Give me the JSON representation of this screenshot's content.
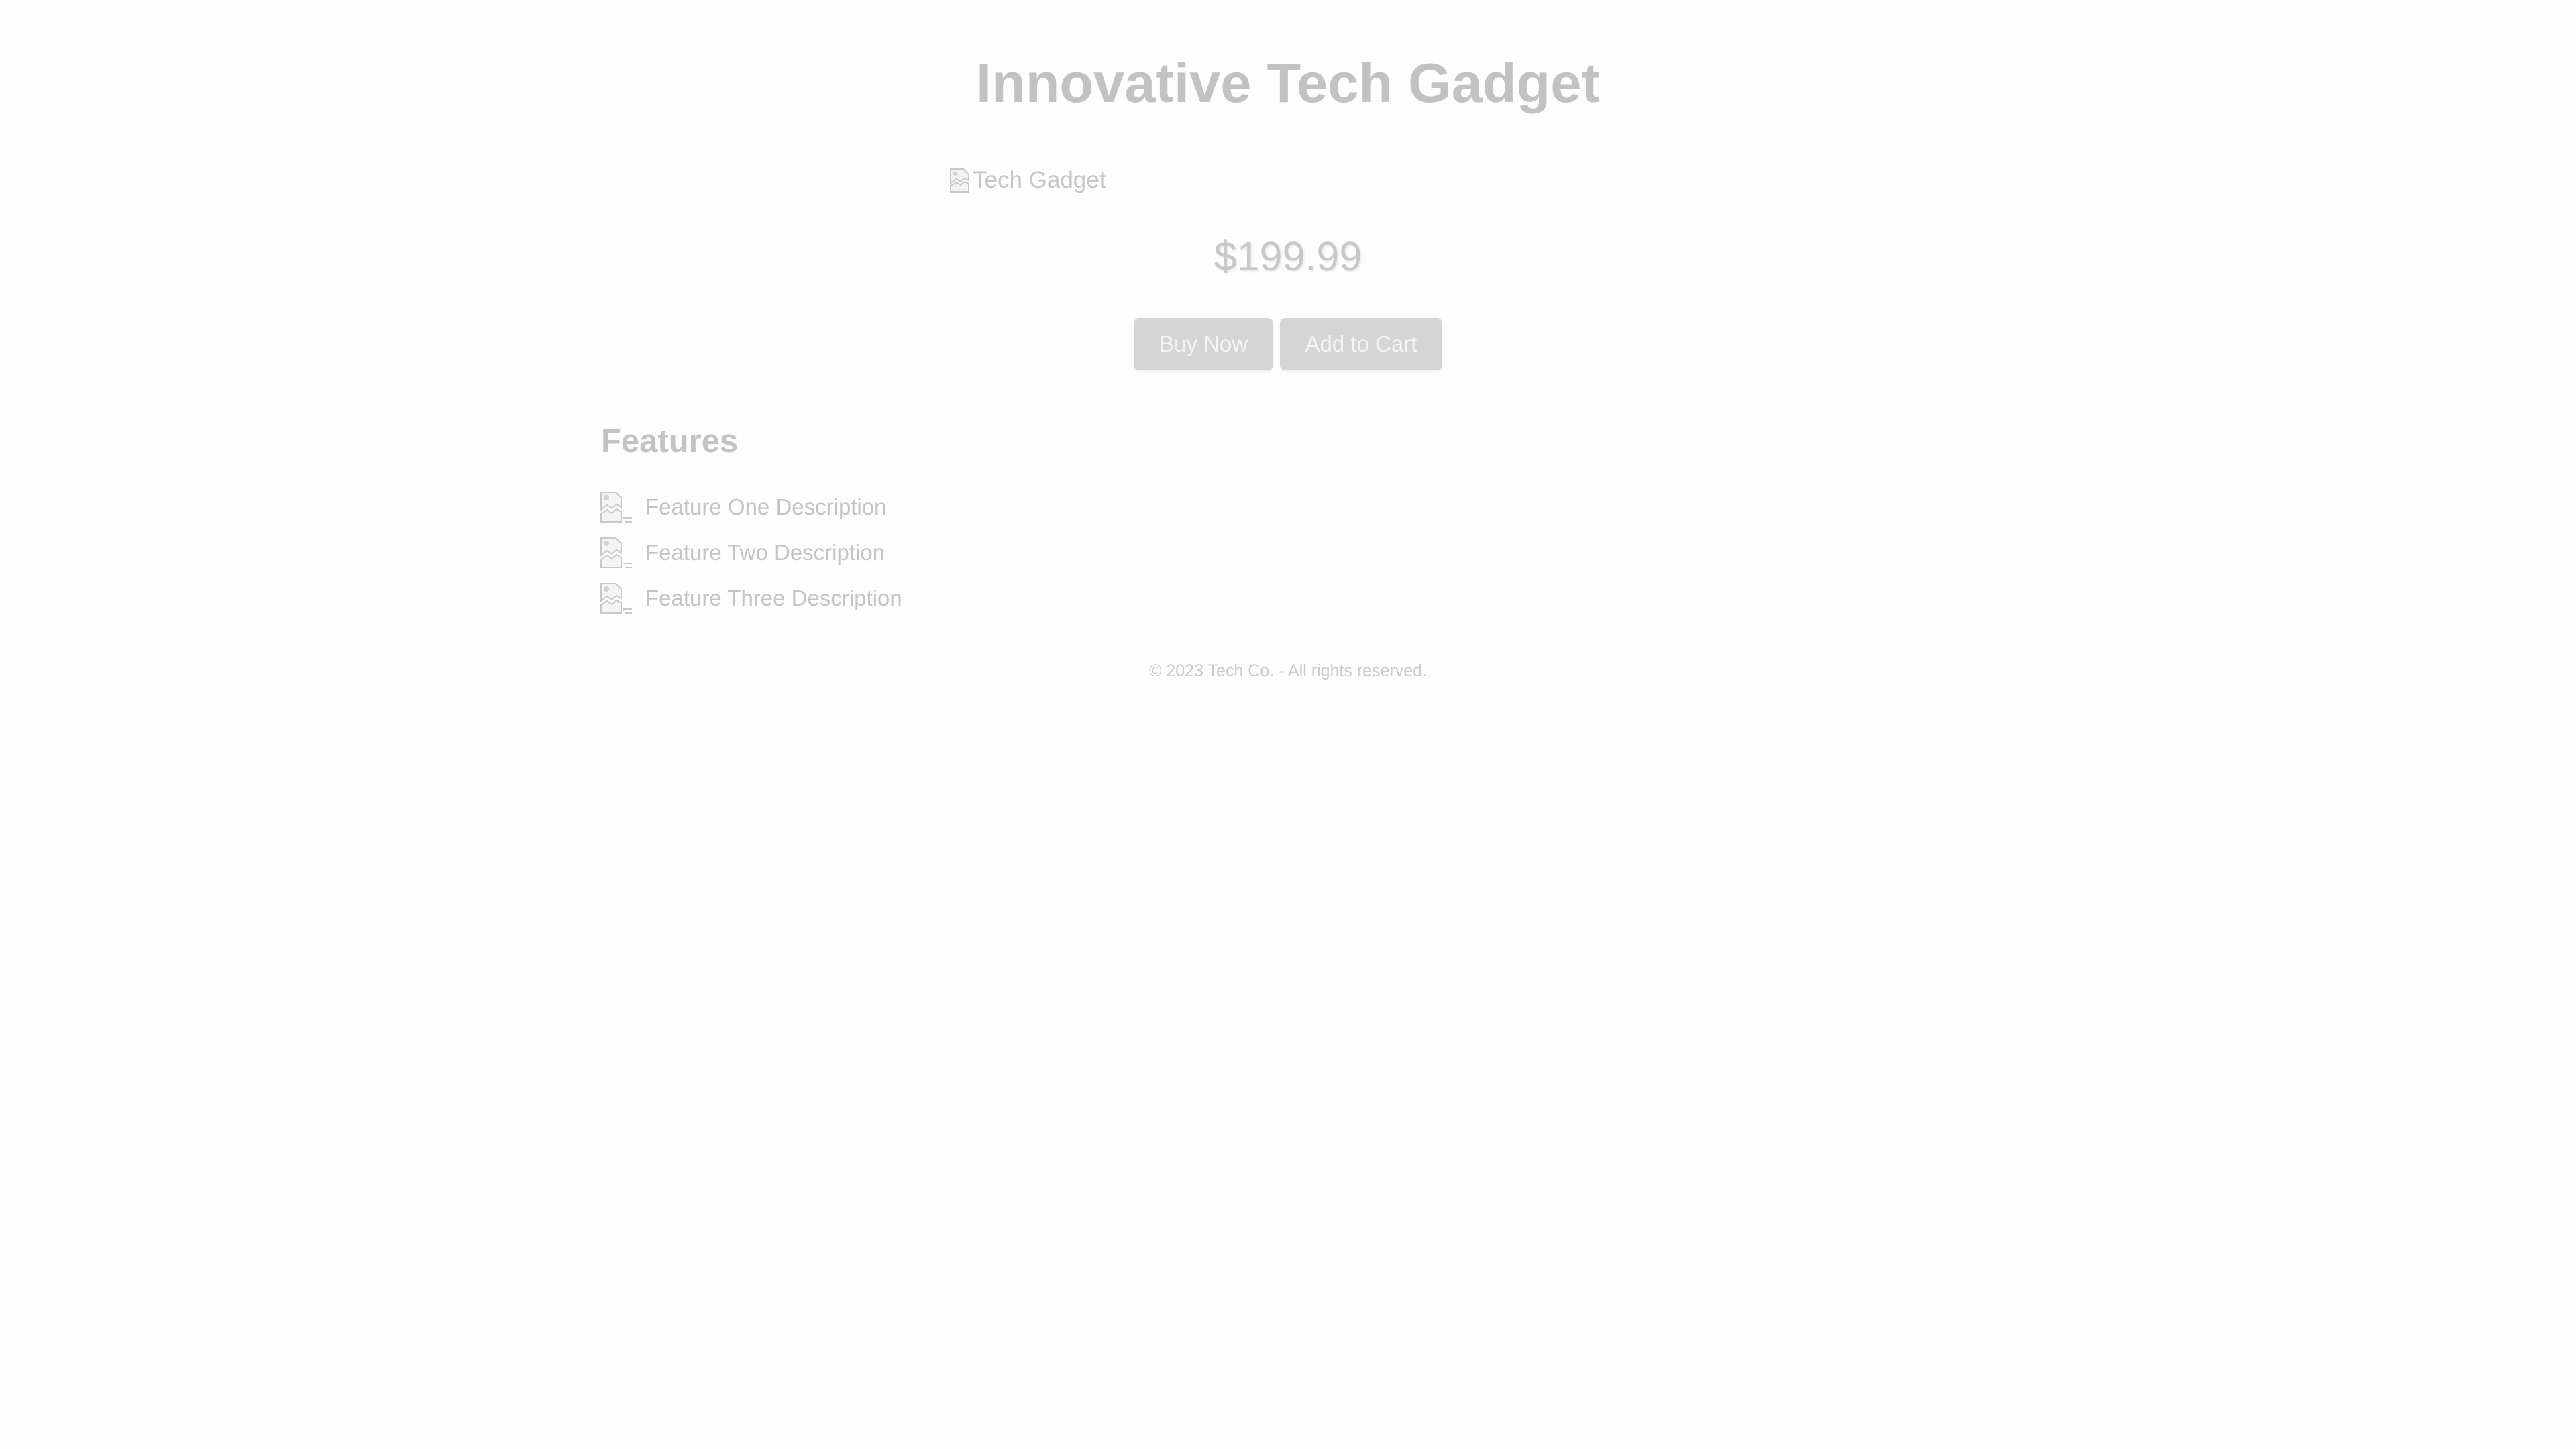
{
  "product": {
    "title": "Innovative Tech Gadget",
    "image_alt": "Tech Gadget",
    "price": "$199.99"
  },
  "actions": {
    "buy_label": "Buy Now",
    "cart_label": "Add to Cart"
  },
  "features": {
    "heading": "Features",
    "items": [
      {
        "label": "Feature One Description",
        "icon": "broken-image-icon"
      },
      {
        "label": "Feature Two Description",
        "icon": "broken-image-icon"
      },
      {
        "label": "Feature Three Description",
        "icon": "broken-image-icon"
      }
    ]
  },
  "footer": {
    "text": "© 2023 Tech Co. - All rights reserved."
  },
  "colors": {
    "background": "#fdfdfd",
    "text": "#c2c2c2",
    "button": "#d5d5d5",
    "button_text": "#f4f4f4"
  }
}
